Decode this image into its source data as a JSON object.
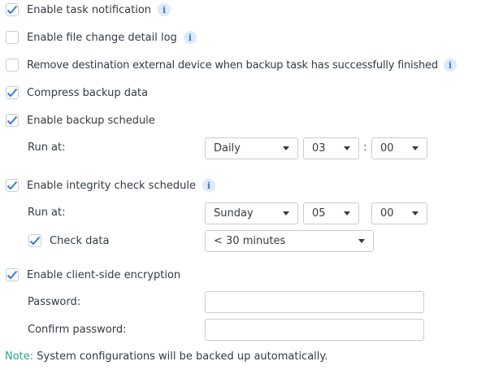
{
  "options": {
    "task_notification": {
      "label": "Enable task notification",
      "checked": true
    },
    "file_change_log": {
      "label": "Enable file change detail log",
      "checked": false
    },
    "remove_destination": {
      "label": "Remove destination external device when backup task has successfully finished",
      "checked": false
    },
    "compress": {
      "label": "Compress backup data",
      "checked": true
    },
    "backup_schedule": {
      "label": "Enable backup schedule",
      "checked": true
    },
    "integrity_check": {
      "label": "Enable integrity check schedule",
      "checked": true
    },
    "encryption": {
      "label": "Enable client-side encryption",
      "checked": true
    }
  },
  "backup_run": {
    "label": "Run at:",
    "frequency": "Daily",
    "hour": "03",
    "separator": ":",
    "minute": "00"
  },
  "integrity_run": {
    "label": "Run at:",
    "day": "Sunday",
    "hour": "05",
    "minute": "00"
  },
  "check_data": {
    "label": "Check data",
    "checked": true,
    "duration": "< 30 minutes"
  },
  "password": {
    "label": "Password:",
    "value": ""
  },
  "confirm_password": {
    "label": "Confirm password:",
    "value": ""
  },
  "note": {
    "key": "Note:",
    "text": "System configurations will be backed up automatically."
  },
  "info_glyph": "i",
  "colors": {
    "accent": "#2f7fd8",
    "note": "#2aa38e",
    "text": "#333b44"
  }
}
